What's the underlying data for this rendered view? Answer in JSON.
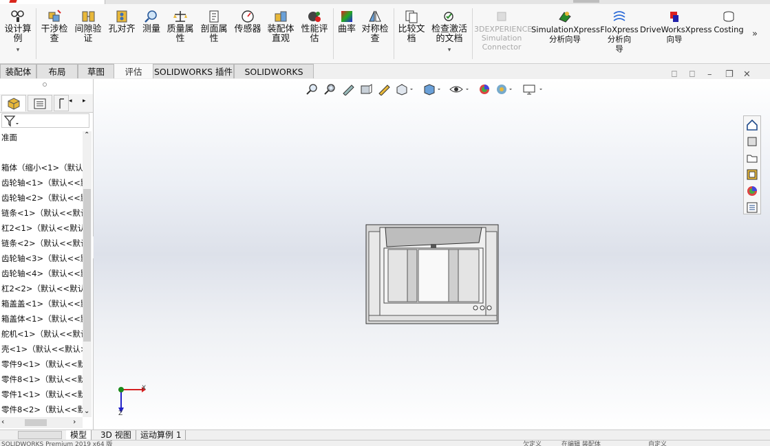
{
  "ribbon": {
    "buttons": [
      {
        "label": "设计算\n例",
        "icon": "design-study-icon"
      },
      {
        "label": "干涉检\n查",
        "icon": "interference-check-icon"
      },
      {
        "label": "间隙验\n证",
        "icon": "clearance-verify-icon"
      },
      {
        "label": "孔对齐",
        "icon": "hole-alignment-icon"
      },
      {
        "label": "测量",
        "icon": "measure-icon"
      },
      {
        "label": "质量属\n性",
        "icon": "mass-properties-icon"
      },
      {
        "label": "剖面属\n性",
        "icon": "section-properties-icon"
      },
      {
        "label": "传感器",
        "icon": "sensor-icon"
      },
      {
        "label": "装配体\n直观",
        "icon": "assembly-visualization-icon"
      },
      {
        "label": "性能评\n估",
        "icon": "performance-evaluation-icon"
      },
      {
        "label": "曲率",
        "icon": "curvature-icon"
      },
      {
        "label": "对称检\n查",
        "icon": "symmetry-check-icon"
      },
      {
        "label": "比较文\n档",
        "icon": "compare-documents-icon"
      },
      {
        "label": "检查激活\n的文档",
        "icon": "check-active-document-icon"
      },
      {
        "label": "3DEXPERIENCE\nSimulation\nConnector",
        "icon": "3dexperience-icon",
        "disabled": true
      },
      {
        "label": "SimulationXpress\n分析向导",
        "icon": "simulationxpress-icon"
      },
      {
        "label": "FloXpress\n分析向\n导",
        "icon": "floxpress-icon"
      },
      {
        "label": "DriveWorksXpress\n向导",
        "icon": "driveworksxpress-icon"
      },
      {
        "label": "Costing",
        "icon": "costing-icon"
      }
    ],
    "more": "»"
  },
  "tabs": [
    {
      "label": "装配体"
    },
    {
      "label": "布局"
    },
    {
      "label": "草图"
    },
    {
      "label": "评估",
      "active": true
    },
    {
      "label": "SOLIDWORKS 插件"
    },
    {
      "label": "SOLIDWORKS MBD"
    }
  ],
  "tree": {
    "header": "准面",
    "items": [
      "箱体（缩小<1>（默认",
      "齿轮轴<1>（默认<<默",
      "齿轮轴<2>（默认<<默",
      "链条<1>（默认<<默认",
      "杠2<1>（默认<<默认",
      "链条<2>（默认<<默认",
      "齿轮轴<3>（默认<<默",
      "齿轮轴<4>（默认<<默",
      "杠2<2>（默认<<默认",
      "箱盖盖<1>（默认<<默",
      "箱盖体<1>（默认<<默",
      "舵机<1>（默认<<默认",
      "壳<1>（默认<<默认>",
      "零件9<1>（默认<<默",
      "零件8<1>（默认<<默",
      "零件1<1>（默认<<默",
      "零件8<2>（默认<<默"
    ]
  },
  "bottom_tabs": [
    {
      "label": "模型",
      "active": true
    },
    {
      "label": "3D 视图"
    },
    {
      "label": "运动算例 1"
    }
  ],
  "statusbar": {
    "left": "SOLIDWORKS Premium 2019 x64 版",
    "mid1": "欠定义",
    "mid2": "在编辑 装配体",
    "mid3": "自定义"
  },
  "triad": {
    "x": "X",
    "z": "Z"
  },
  "colors": {
    "triad_x": "#d42020",
    "triad_y": "#1c8a1c",
    "triad_z": "#2020c8"
  }
}
